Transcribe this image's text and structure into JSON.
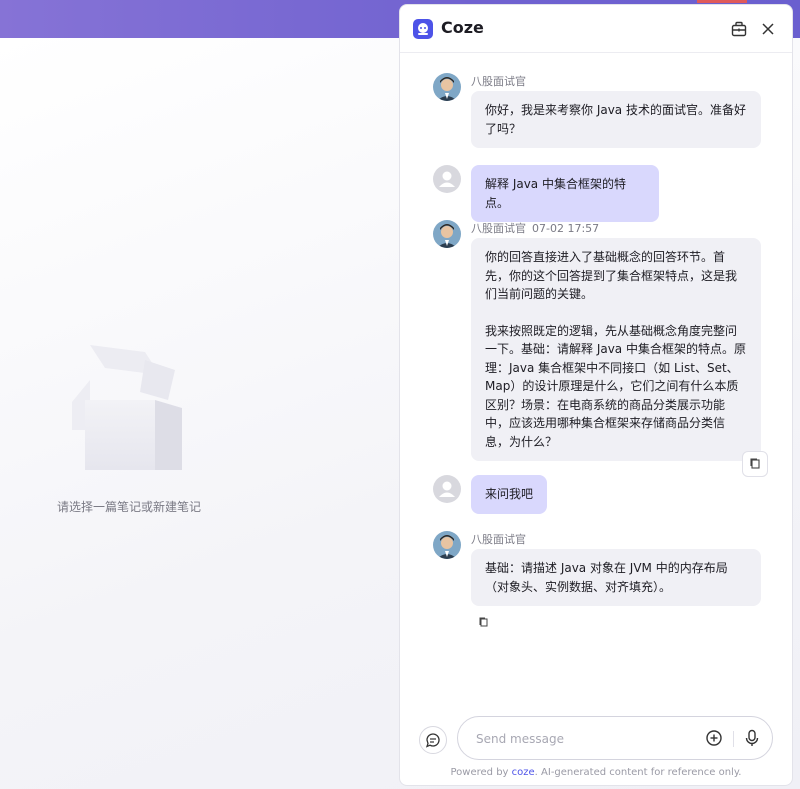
{
  "panel": {
    "title": "Coze",
    "icons": {
      "logo": "coze-logo-icon",
      "bag": "shopping-bag-icon",
      "close": "close-icon"
    }
  },
  "background": {
    "empty_text": "请选择一篇笔记或新建笔记",
    "illustration": "empty-box-icon"
  },
  "messages": [
    {
      "role": "bot",
      "sender": "八股面试官",
      "time": "",
      "text": "你好，我是来考察你 Java 技术的面试官。准备好了吗？"
    },
    {
      "role": "user",
      "text": "解释 Java 中集合框架的特点。"
    },
    {
      "role": "bot",
      "sender": "八股面试官",
      "time": "07-02 17:57",
      "paragraphs": [
        "你的回答直接进入了基础概念的回答环节。首先，你的这个回答提到了集合框架特点，这是我们当前问题的关键。",
        "我来按照既定的逻辑，先从基础概念角度完整问一下。基础：请解释 Java 中集合框架的特点。原理：Java 集合框架中不同接口（如 List、Set、Map）的设计原理是什么，它们之间有什么本质区别？场景：在电商系统的商品分类展示功能中，应该选用哪种集合框架来存储商品分类信息，为什么？"
      ]
    },
    {
      "role": "user",
      "text": "来问我吧"
    },
    {
      "role": "bot",
      "sender": "八股面试官",
      "time": "",
      "text": "基础：请描述 Java 对象在 JVM 中的内存布局（对象头、实例数据、对齐填充）。"
    }
  ],
  "composer": {
    "placeholder": "Send message",
    "icons": {
      "clear": "clear-context-icon",
      "plus": "plus-circle-icon",
      "mic": "microphone-icon",
      "copy": "copy-icon"
    }
  },
  "footer": {
    "prefix": "Powered by ",
    "link": "coze",
    "suffix": ". AI-generated content for reference only."
  },
  "colors": {
    "accent": "#4d53e8",
    "user_bubble": "#d9d8fd",
    "bot_bubble": "#f0f0f5",
    "top_bar": "#7062d0"
  }
}
